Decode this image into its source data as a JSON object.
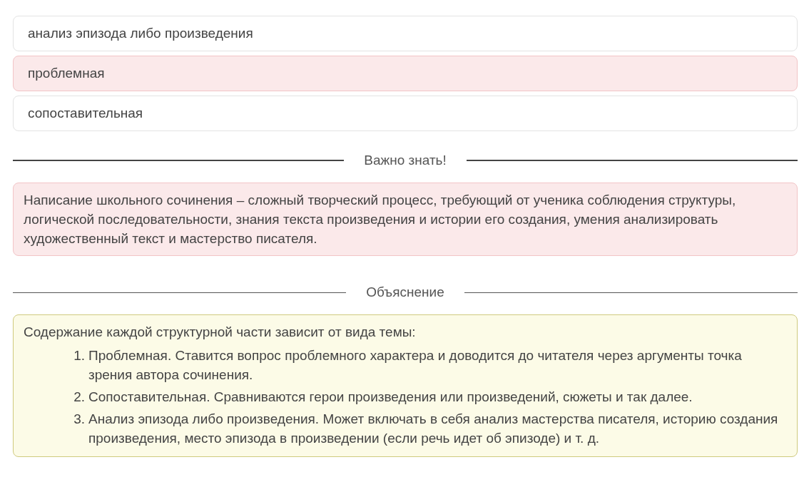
{
  "options": [
    {
      "label": "анализ эпизода либо произведения",
      "selected": false
    },
    {
      "label": "проблемная",
      "selected": true
    },
    {
      "label": "сопоставительная",
      "selected": false
    }
  ],
  "important": {
    "heading": "Важно знать!",
    "text": "Написание школьного сочинения – сложный творческий процесс, требующий от ученика соблюдения структуры, логической последовательности, знания текста произведения и истории его создания, умения анализировать художественный текст и мастерство писателя."
  },
  "explanation": {
    "heading": "Объяснение",
    "intro": "Содержание каждой структурной части зависит от вида темы:",
    "items": [
      {
        "number": "1.",
        "text": "Проблемная. Ставится вопрос проблемного характера и доводится до читателя через аргументы точка зрения автора сочинения."
      },
      {
        "number": "2.",
        "text": "Сопоставительная. Сравниваются герои произведения или произведений, сюжеты и так далее."
      },
      {
        "number": "3.",
        "text": "Анализ эпизода либо произведения. Может включать в себя анализ мастерства писателя, историю создания произведения, место эпизода в произведении (если речь идет об эпизоде) и т. д."
      }
    ]
  }
}
